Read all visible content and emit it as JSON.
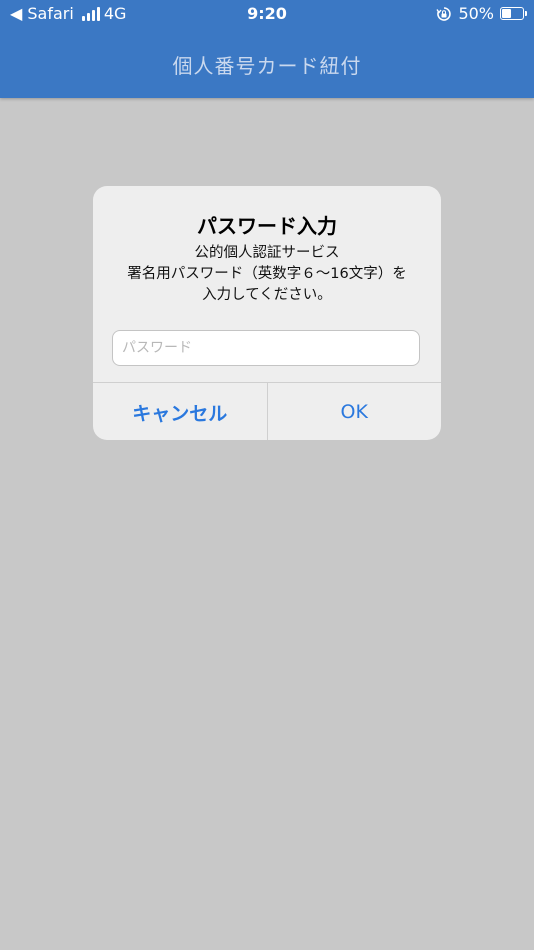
{
  "status_bar": {
    "back_label": "◀ Safari",
    "network": "4G",
    "time": "9:20",
    "battery_percent": "50%",
    "battery_level": 0.5
  },
  "header": {
    "title": "個人番号カード紐付"
  },
  "dialog": {
    "title": "パスワード入力",
    "message_lines": [
      "公的個人認証サービス",
      "署名用パスワード（英数字６〜16文字）を",
      "入力してください。"
    ],
    "password_placeholder": "パスワード",
    "password_value": "",
    "cancel_label": "キャンセル",
    "ok_label": "OK"
  },
  "colors": {
    "header": "#3b78c4",
    "background": "#c8c8c8",
    "accent": "#2a78de"
  },
  "icons": {
    "back": "back-arrow-icon",
    "signal": "cellular-signal-icon",
    "orientation_lock": "orientation-lock-icon",
    "battery": "battery-icon"
  }
}
